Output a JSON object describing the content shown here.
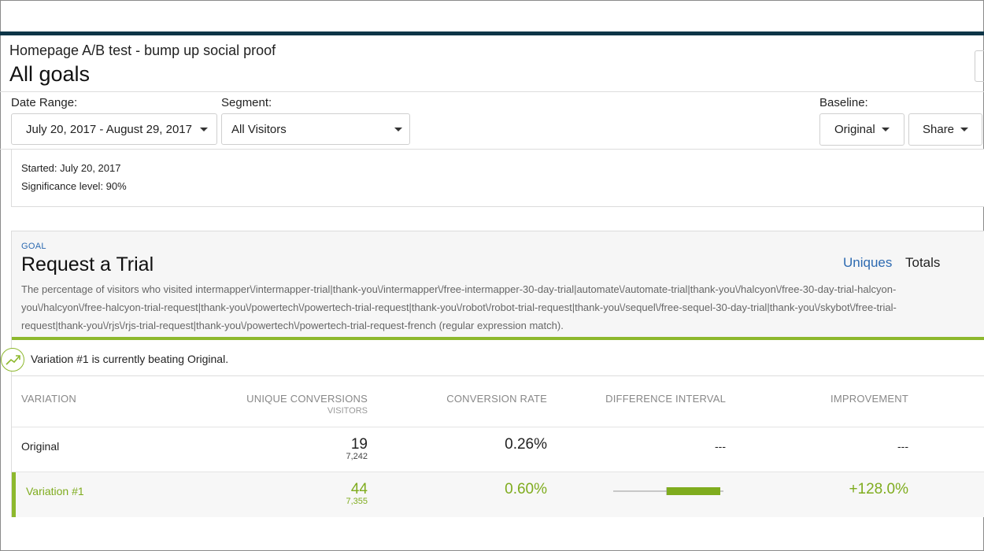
{
  "experiment": {
    "name": "Homepage A/B test - bump up social proof",
    "view_title": "All goals"
  },
  "filters": {
    "date_range": {
      "label": "Date Range:",
      "value": "July 20, 2017 - August 29, 2017"
    },
    "segment": {
      "label": "Segment:",
      "value": "All Visitors"
    },
    "baseline": {
      "label": "Baseline:",
      "value": "Original"
    },
    "share_label": "Share"
  },
  "info": {
    "started": "Started: July 20, 2017",
    "significance": "Significance level: 90%"
  },
  "goal": {
    "tag": "GOAL",
    "title": "Request a Trial",
    "toggle": {
      "uniques": "Uniques",
      "totals": "Totals",
      "active": "uniques"
    },
    "description_lines": [
      "The percentage of visitors who visited intermapper\\/intermapper-trial|thank-you\\/intermapper\\/free-intermapper-30-day-trial|automate\\/automate-trial|thank-you\\/halcyon\\/free-30-day-trial-halcyon-",
      "you\\/halcyon\\/free-halcyon-trial-request|thank-you\\/powertech\\/powertech-trial-request|thank-you\\/robot\\/robot-trial-request|thank-you\\/sequel\\/free-sequel-30-day-trial|thank-you\\/skybot\\/free-trial-",
      "request|thank-you\\/rjs\\/rjs-trial-request|thank-you\\/powertech\\/powertech-trial-request-french (regular expression match)."
    ],
    "banner": "Variation #1 is currently beating Original.",
    "columns": {
      "variation": "VARIATION",
      "conversions": "UNIQUE CONVERSIONS",
      "conversions_sub": "VISITORS",
      "rate": "CONVERSION RATE",
      "interval": "DIFFERENCE INTERVAL",
      "improvement": "IMPROVEMENT"
    },
    "rows": [
      {
        "name": "Original",
        "conversions": "19",
        "visitors": "7,242",
        "rate": "0.26%",
        "interval": "---",
        "improvement": "---"
      },
      {
        "name": "Variation #1",
        "conversions": "44",
        "visitors": "7,355",
        "rate": "0.60%",
        "improvement": "+128.0%"
      }
    ]
  },
  "colors": {
    "accent_green": "#8db82d",
    "link_blue": "#2d6ab1",
    "top_bar": "#0d3547"
  }
}
